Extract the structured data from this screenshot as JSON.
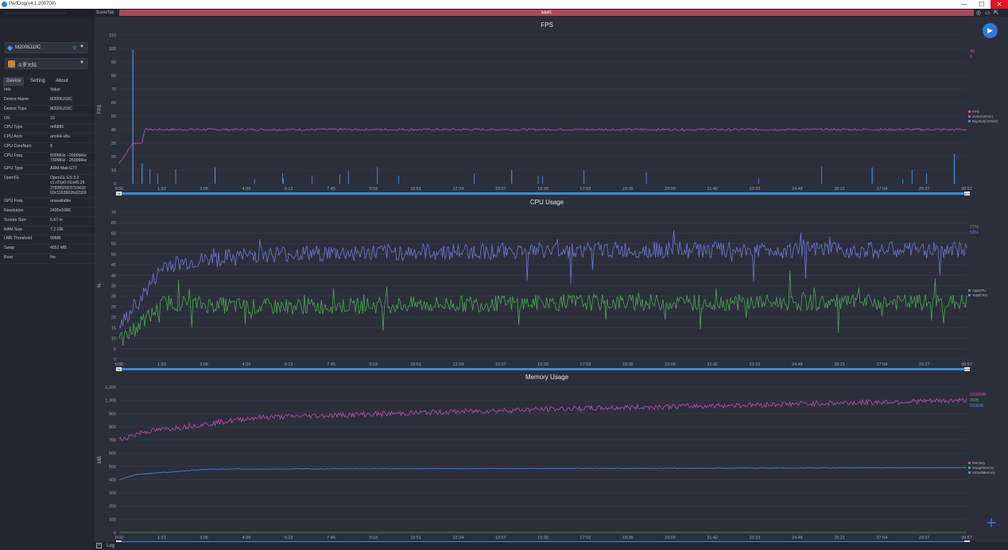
{
  "window": {
    "title": "PerfDog(v4.1.200708)",
    "minimize": "—",
    "maximize": "☐",
    "close": "✕"
  },
  "sidebar": {
    "device": "M2006J10C",
    "app": "斗罗大陆",
    "tabs": [
      "Device",
      "Setting",
      "About"
    ],
    "info_header": {
      "key": "Info",
      "value": "Value"
    },
    "info_rows": [
      {
        "k": "Device Name",
        "v": "M2006J10C"
      },
      {
        "k": "Device Type",
        "v": "M2006J10C"
      },
      {
        "k": "OS",
        "v": "10"
      },
      {
        "k": "CPU Type",
        "v": "mt6885"
      },
      {
        "k": "CPU Arch",
        "v": "arm64-v8a"
      },
      {
        "k": "CPU CoreNum",
        "v": "8"
      },
      {
        "k": "CPU Freq",
        "v": "500MHz - 2000MHz\n730MHz - 2600MHz"
      },
      {
        "k": "GPU Type",
        "v": "ARM Mali-G77"
      },
      {
        "k": "OpenGL",
        "v": "OpenGL ES 3.2\nv1.r21p0-01rel0.26\n2783f92023710420\n03c11639026d2009"
      },
      {
        "k": "GPU Freq",
        "v": "unavailable"
      },
      {
        "k": "Resolution",
        "v": "2400x1080"
      },
      {
        "k": "Screen Size",
        "v": "6.67 in"
      },
      {
        "k": "RAM Size",
        "v": "7.2 GB"
      },
      {
        "k": "LMK Threshold",
        "v": "99MB"
      },
      {
        "k": "Swap",
        "v": "4052 MB"
      },
      {
        "k": "Root",
        "v": "No"
      }
    ]
  },
  "toolbar": {
    "scene_label": "SceneTab",
    "label_strip": "label1"
  },
  "logbar": {
    "toggle": "+",
    "label": "Log"
  },
  "colors": {
    "fps": "#c64bb7",
    "fps_jank": "#d65287",
    "fps_bigjank": "#4a90e2",
    "app_cpu": "#49a84f",
    "total_cpu": "#6a79d6",
    "memory": "#c64bb7",
    "swap_memory": "#49a84f",
    "virtual_memory": "#3d8fe0",
    "accent": "#2f78e0"
  },
  "x_ticks": [
    "0:00",
    "1:33",
    "3:06",
    "4:39",
    "6:12",
    "7:45",
    "9:18",
    "10:51",
    "12:24",
    "13:57",
    "15:30",
    "17:03",
    "18:36",
    "20:09",
    "21:42",
    "23:15",
    "24:48",
    "26:21",
    "27:54",
    "29:27",
    "30:57"
  ],
  "range_start_label": "0s",
  "range_end_label": "30:57",
  "chart_data": [
    {
      "type": "line",
      "title": "FPS",
      "ylabel": "FPS",
      "ylim": [
        0,
        110
      ],
      "yticks": [
        "0",
        "10",
        "20",
        "30",
        "40",
        "50",
        "60",
        "70",
        "80",
        "90",
        "100",
        "110"
      ],
      "series": [
        {
          "name": "FPS",
          "points": [
            [
              0,
              15
            ],
            [
              30,
              30
            ],
            [
              50,
              30
            ],
            [
              55,
              40
            ],
            [
              1857,
              40
            ]
          ]
        },
        {
          "name": "Jank(/10min)",
          "points": []
        },
        {
          "name": "BigJank(/10min)",
          "points": [
            [
              30,
              99
            ],
            [
              50,
              15
            ],
            [
              210,
              12
            ],
            [
              860,
              10
            ],
            [
              1650,
              12
            ],
            [
              1830,
              22
            ]
          ]
        }
      ],
      "top_right_values": [
        "40",
        "0"
      ]
    },
    {
      "type": "line",
      "title": "CPU Usage",
      "ylabel": "%",
      "ylim": [
        0,
        70
      ],
      "yticks": [
        "0",
        "5",
        "10",
        "15",
        "20",
        "25",
        "30",
        "35",
        "40",
        "45",
        "50",
        "55",
        "60",
        "65",
        "70"
      ],
      "series": [
        {
          "name": "AppCPU",
          "points": [
            [
              0,
              8
            ],
            [
              100,
              27
            ],
            [
              300,
              25
            ],
            [
              1000,
              27
            ],
            [
              1857,
              27
            ]
          ]
        },
        {
          "name": "TotalCPU",
          "points": [
            [
              0,
              15
            ],
            [
              100,
              45
            ],
            [
              300,
              50
            ],
            [
              1000,
              52
            ],
            [
              1857,
              52
            ]
          ]
        }
      ],
      "top_right_values": [
        "27%",
        "52%"
      ]
    },
    {
      "type": "line",
      "title": "Memory Usage",
      "ylabel": "MB",
      "ylim": [
        0,
        1100
      ],
      "yticks": [
        "0",
        "100",
        "200",
        "300",
        "400",
        "500",
        "600",
        "700",
        "800",
        "900",
        "1,000",
        "1,100"
      ],
      "series": [
        {
          "name": "Memory",
          "points": [
            [
              0,
              700
            ],
            [
              50,
              760
            ],
            [
              300,
              870
            ],
            [
              900,
              930
            ],
            [
              1857,
              1000
            ]
          ]
        },
        {
          "name": "SwapMemory",
          "points": [
            [
              0,
              0
            ],
            [
              1857,
              0
            ]
          ]
        },
        {
          "name": "VirtualMemory",
          "points": [
            [
              0,
              400
            ],
            [
              40,
              440
            ],
            [
              200,
              480
            ],
            [
              1857,
              490
            ]
          ]
        }
      ],
      "top_right_values": [
        "1000MB",
        "0MB",
        "503MB"
      ]
    }
  ]
}
